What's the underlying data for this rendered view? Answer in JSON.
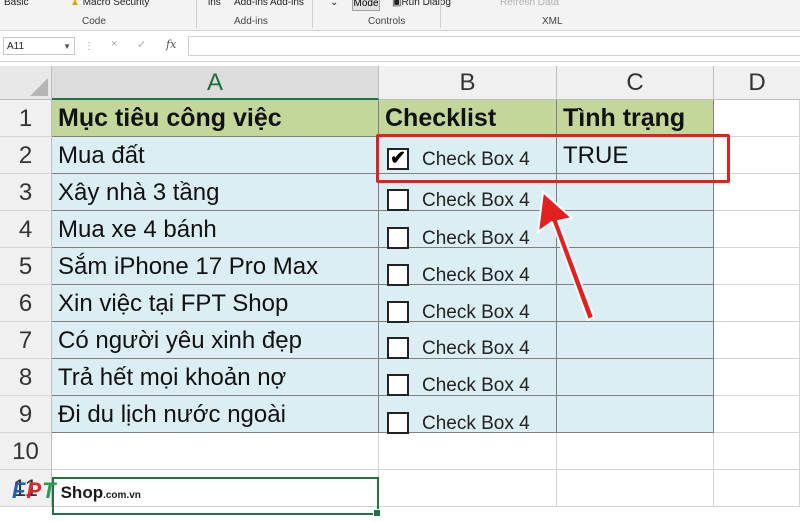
{
  "ribbon": {
    "items": [
      "Basic",
      "Macro Security",
      "ins",
      "Add-ins",
      "Add-ins",
      "Mode",
      "Run Dialog",
      "Refresh Data"
    ],
    "groups": [
      "Code",
      "Add-ins",
      "Controls",
      "XML"
    ]
  },
  "formula_bar": {
    "name_box": "A11",
    "fx_label": "fx",
    "cancel_icon": "×",
    "enter_icon": "✓",
    "formula": ""
  },
  "columns": [
    "A",
    "B",
    "C",
    "D"
  ],
  "rows": [
    "1",
    "2",
    "3",
    "4",
    "5",
    "6",
    "7",
    "8",
    "9",
    "10",
    "11"
  ],
  "header_row": {
    "a": "Mục tiêu công việc",
    "b": "Checklist",
    "c": "Tình trạng"
  },
  "tasks": [
    {
      "goal": "Mua đất",
      "checkbox_label": "Check Box 4",
      "checked": true,
      "status": "TRUE"
    },
    {
      "goal": "Xây nhà 3 tầng",
      "checkbox_label": "Check Box 4",
      "checked": false,
      "status": ""
    },
    {
      "goal": "Mua xe 4 bánh",
      "checkbox_label": "Check Box 4",
      "checked": false,
      "status": ""
    },
    {
      "goal": "Sắm iPhone 17 Pro Max",
      "checkbox_label": "Check Box 4",
      "checked": false,
      "status": ""
    },
    {
      "goal": "Xin việc tại FPT Shop",
      "checkbox_label": "Check Box 4",
      "checked": false,
      "status": ""
    },
    {
      "goal": "Có người yêu xinh đẹp",
      "checkbox_label": "Check Box 4",
      "checked": false,
      "status": ""
    },
    {
      "goal": "Trả hết mọi khoản nợ",
      "checkbox_label": "Check Box 4",
      "checked": false,
      "status": ""
    },
    {
      "goal": "Đi du lịch nước ngoài",
      "checkbox_label": "Check Box 4",
      "checked": false,
      "status": ""
    }
  ],
  "checkmark_glyph": "✔",
  "watermark": {
    "brand_f": "F",
    "brand_p": "P",
    "brand_t": "T",
    "shop": "Shop",
    "domain": ".com.vn"
  },
  "colors": {
    "header_fill": "#c4d79b",
    "data_fill": "#daeef3",
    "highlight": "#e32020",
    "excel_green": "#217346"
  }
}
